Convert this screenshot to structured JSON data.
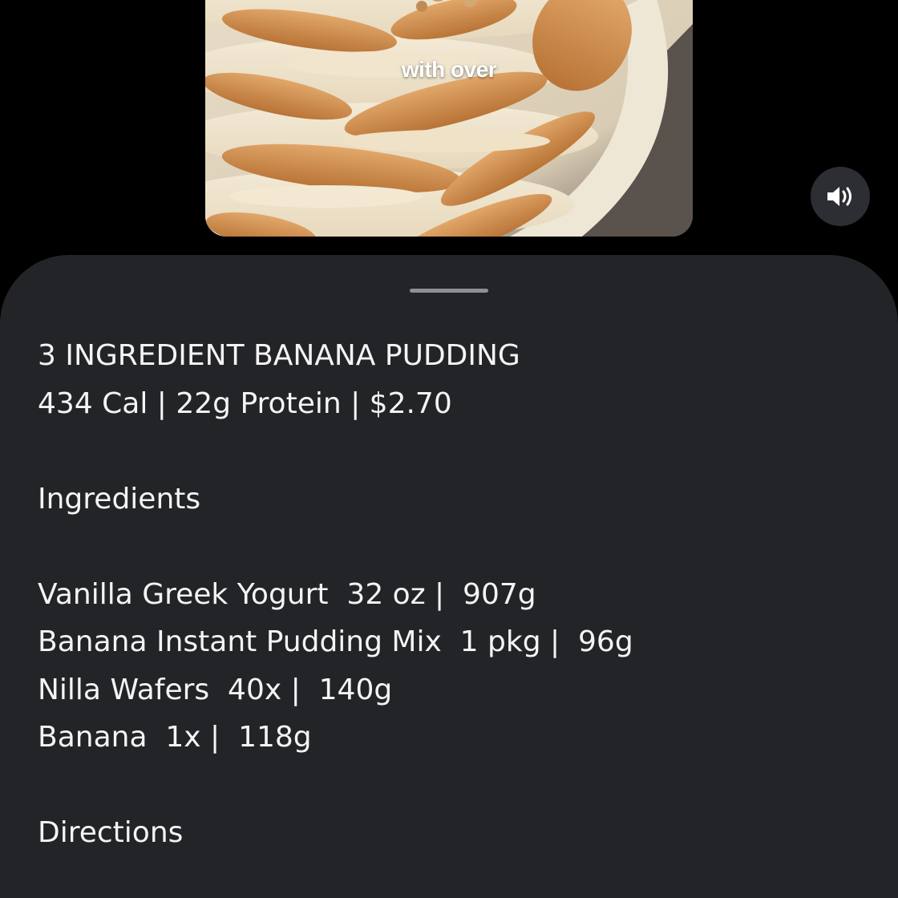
{
  "video": {
    "caption": "with over"
  },
  "controls": {
    "volume_icon": "speaker-volume-icon"
  },
  "colors": {
    "background": "#000000",
    "sheet": "#232428",
    "text": "#f4f4f4",
    "handle": "#8d9096",
    "button": "#2c2e33"
  },
  "recipe": {
    "title": "3 INGREDIENT BANANA PUDDING",
    "stats": "434 Cal | 22g Protein | $2.70",
    "ingredients_heading": "Ingredients",
    "ingredients": [
      "Vanilla Greek Yogurt  32 oz |  907g",
      "Banana Instant Pudding Mix  1 pkg |  96g",
      "Nilla Wafers  40x |  140g",
      "Banana  1x |  118g"
    ],
    "directions_heading": "Directions"
  }
}
